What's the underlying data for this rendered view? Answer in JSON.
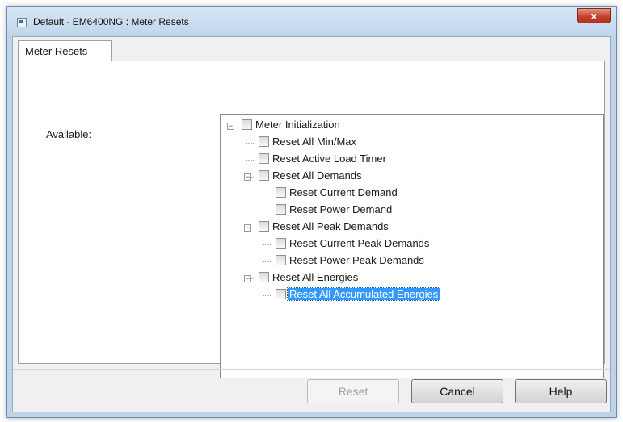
{
  "window": {
    "title": "Default - EM6400NG : Meter Resets",
    "close_glyph": "x"
  },
  "tabs": [
    {
      "label": "Meter Resets",
      "active": true
    }
  ],
  "available_label": "Available:",
  "tree": [
    {
      "label": "Meter Initialization",
      "level": 0,
      "expandable": true,
      "expanded": true,
      "checked": false,
      "selected": false
    },
    {
      "label": "Reset All Min/Max",
      "level": 1,
      "expandable": false,
      "checked": false,
      "selected": false
    },
    {
      "label": "Reset Active Load Timer",
      "level": 1,
      "expandable": false,
      "checked": false,
      "selected": false
    },
    {
      "label": "Reset All Demands",
      "level": 1,
      "expandable": true,
      "expanded": true,
      "checked": false,
      "selected": false
    },
    {
      "label": "Reset Current Demand",
      "level": 2,
      "expandable": false,
      "checked": false,
      "selected": false
    },
    {
      "label": "Reset Power Demand",
      "level": 2,
      "expandable": false,
      "checked": false,
      "selected": false
    },
    {
      "label": "Reset All Peak Demands",
      "level": 1,
      "expandable": true,
      "expanded": true,
      "checked": false,
      "selected": false
    },
    {
      "label": "Reset Current Peak Demands",
      "level": 2,
      "expandable": false,
      "checked": false,
      "selected": false
    },
    {
      "label": "Reset Power Peak Demands",
      "level": 2,
      "expandable": false,
      "checked": false,
      "selected": false
    },
    {
      "label": "Reset All Energies",
      "level": 1,
      "expandable": true,
      "expanded": true,
      "checked": false,
      "selected": false
    },
    {
      "label": "Reset All Accumulated Energies",
      "level": 2,
      "expandable": false,
      "checked": false,
      "selected": true
    }
  ],
  "buttons": {
    "reset": "Reset",
    "cancel": "Cancel",
    "help": "Help"
  },
  "colors": {
    "selection": "#3399ff",
    "title_bar": "#bfd5ec",
    "close_button": "#c4412a"
  },
  "icons": {
    "app": "app-window-icon",
    "close": "close-icon",
    "expander": "tree-collapse-icon",
    "checkbox": "checkbox"
  }
}
